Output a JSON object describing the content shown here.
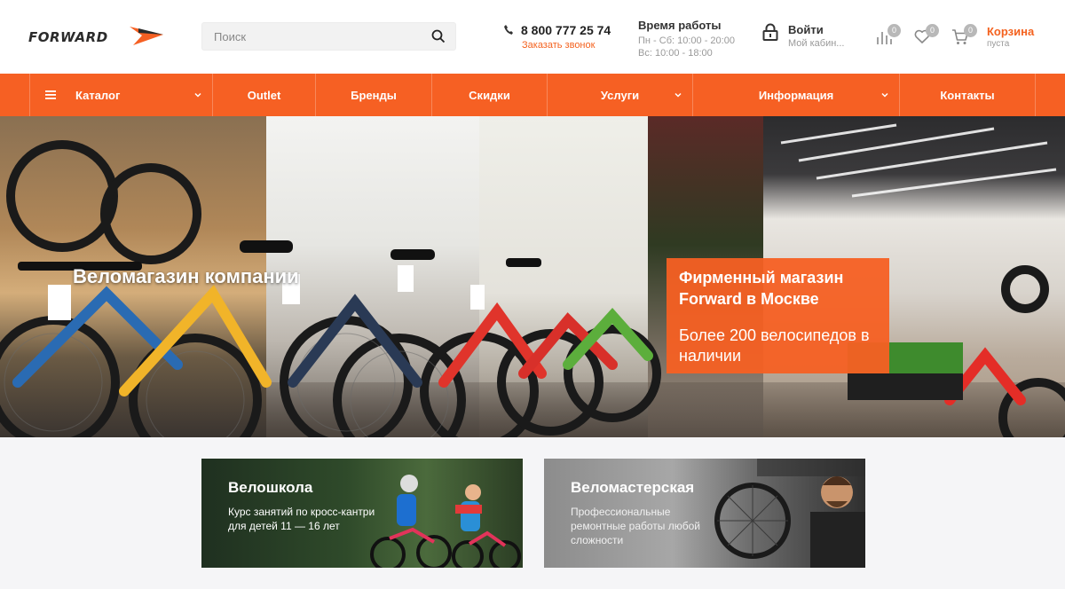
{
  "header": {
    "logo_text": "FORWARD",
    "search_placeholder": "Поиск",
    "phone": "8 800 777 25 74",
    "callback": "Заказать звонок",
    "hours_title": "Время работы",
    "hours_weekdays": "Пн - Сб: 10:00 - 20:00",
    "hours_sunday": "Вс: 10:00 - 18:00",
    "login_title": "Войти",
    "login_sub": "Мой кабин...",
    "compare_count": "0",
    "wishlist_count": "0",
    "cart_count": "0",
    "cart_title": "Корзина",
    "cart_sub": "пуста"
  },
  "nav": {
    "items": [
      {
        "label": "Каталог",
        "dropdown": true
      },
      {
        "label": "Outlet",
        "dropdown": false
      },
      {
        "label": "Бренды",
        "dropdown": false
      },
      {
        "label": "Скидки",
        "dropdown": false
      },
      {
        "label": "Услуги",
        "dropdown": true
      },
      {
        "label": "Информация",
        "dropdown": true
      },
      {
        "label": "Контакты",
        "dropdown": false
      }
    ]
  },
  "hero": {
    "title": "Веломагазин компании",
    "promo_title": "Фирменный магазин Forward в Москве",
    "promo_text": "Более 200 велосипедов в наличии"
  },
  "cards": {
    "school": {
      "title": "Велошкола",
      "text": "Курс занятий по кросс-кантри для детей 11 — 16 лет"
    },
    "repair": {
      "title": "Веломастерская",
      "text": "Профессиональные ремонтные работы любой сложности"
    }
  },
  "colors": {
    "accent": "#f66023",
    "badge": "#b8b8b8"
  },
  "icons": [
    "search-icon",
    "phone-icon",
    "lock-icon",
    "compare-icon",
    "heart-icon",
    "cart-icon",
    "menu-icon",
    "chevron-down-icon"
  ]
}
